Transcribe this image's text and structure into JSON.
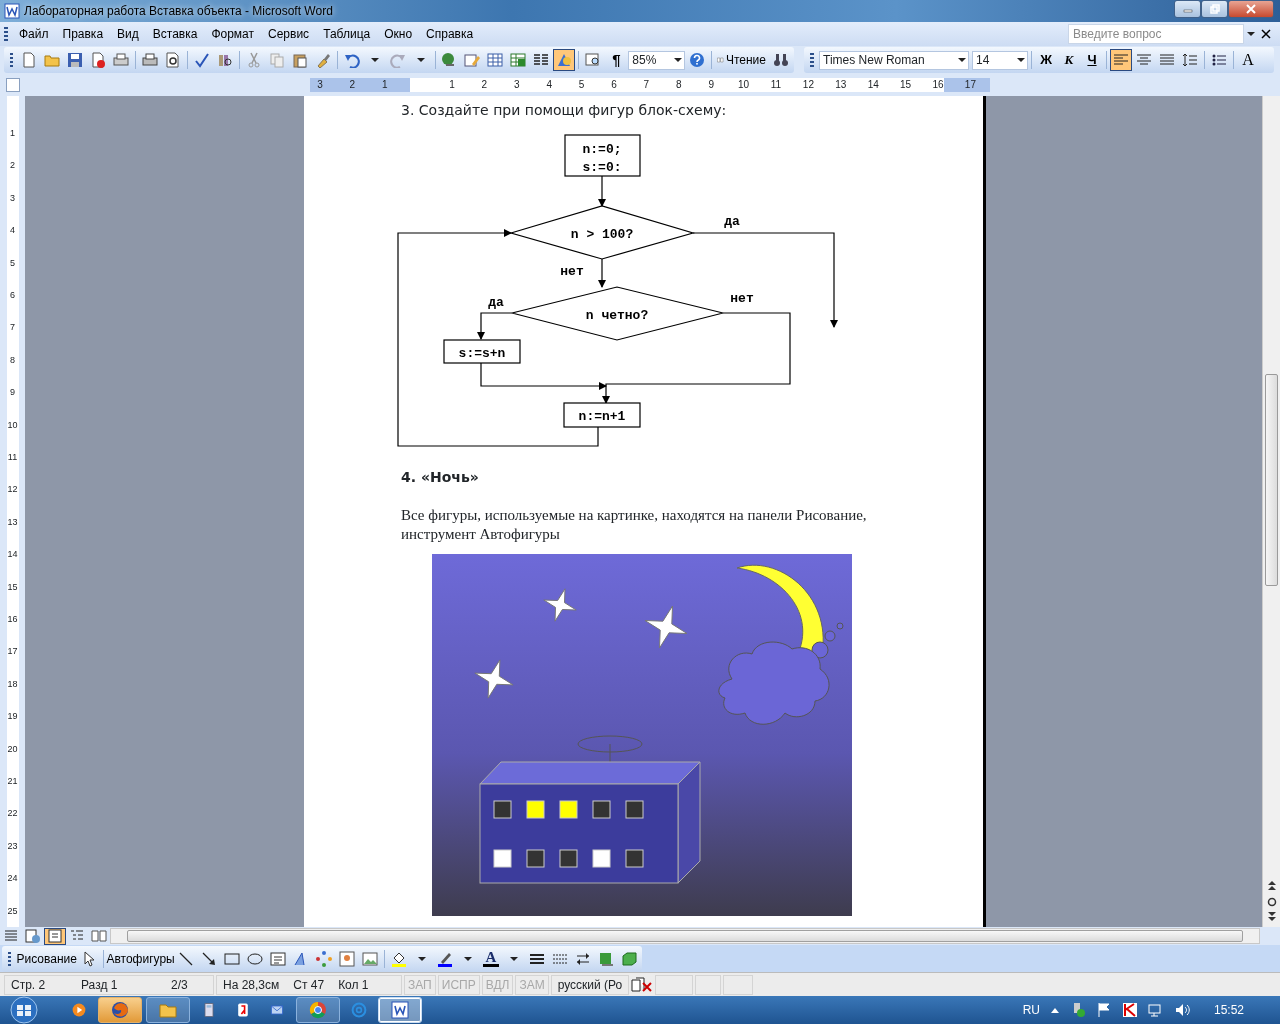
{
  "window": {
    "title": "Лабораторная работа Вставка объекта - Microsoft Word"
  },
  "menu": [
    {
      "label": "Файл"
    },
    {
      "label": "Правка"
    },
    {
      "label": "Вид"
    },
    {
      "label": "Вставка"
    },
    {
      "label": "Формат"
    },
    {
      "label": "Сервис"
    },
    {
      "label": "Таблица"
    },
    {
      "label": "Окно"
    },
    {
      "label": "Справка"
    }
  ],
  "help_box": {
    "placeholder": "Введите вопрос"
  },
  "standard_toolbar": {
    "show_marks_glyph": "¶",
    "zoom": "85%",
    "read_button": "Чтение",
    "drawing_toggle": {
      "on": true
    }
  },
  "formatting_toolbar": {
    "font": "Times New Roman",
    "size": "14",
    "grow_font_glyph": "A",
    "styles": [
      {
        "label": "Ж",
        "on": false
      },
      {
        "label": "К",
        "on": false
      },
      {
        "label": "Ч",
        "on": false
      }
    ],
    "alignment": [
      {
        "kind": "left",
        "selected": true
      },
      {
        "kind": "center",
        "selected": false
      },
      {
        "kind": "justify",
        "selected": false
      }
    ]
  },
  "ruler": {
    "left_numbers": [
      "3",
      "2",
      "1"
    ],
    "numbers": [
      "1",
      "2",
      "3",
      "4",
      "5",
      "6",
      "7",
      "8",
      "9",
      "10",
      "11",
      "12",
      "13",
      "14",
      "15",
      "16",
      "17"
    ]
  },
  "vertical_ruler": {
    "numbers": [
      "1",
      "2",
      "3",
      "4",
      "5",
      "6",
      "7",
      "8",
      "9",
      "10",
      "11",
      "12",
      "13",
      "14",
      "15",
      "16",
      "17",
      "18",
      "19",
      "20",
      "21",
      "22",
      "23",
      "24",
      "25"
    ]
  },
  "document": {
    "heading_1": "3. Создайте при помощи фигур блок-схему:",
    "flowchart": {
      "start_block": [
        "n:=0;",
        "s:=0:"
      ],
      "condition_1": "n > 100?",
      "condition_1_yes": "да",
      "condition_1_no": "нет",
      "condition_2": "n четно?",
      "condition_2_yes": "да",
      "condition_2_no": "нет",
      "sum_block": "s:=s+n",
      "step_block": "n:=n+1"
    },
    "heading_2": "4. «Ночь»",
    "paragraph": "Все фигуры, используемые на картинке, находятся на панели Рисование, инструмент Автофигуры"
  },
  "view_buttons": [
    {
      "kind": "normal",
      "selected": false
    },
    {
      "kind": "web",
      "selected": false
    },
    {
      "kind": "print",
      "selected": true
    },
    {
      "kind": "outline",
      "selected": false
    },
    {
      "kind": "reading",
      "selected": false
    }
  ],
  "drawing_toolbar": {
    "drawing_menu": "Рисование",
    "autoshapes_menu": "Автофигуры",
    "font_color_glyph": "A"
  },
  "status_bar": {
    "page": "Стр. 2",
    "section": "Разд 1",
    "pages": "2/3",
    "position": "На 28,3см",
    "line": "Ст 47",
    "column": "Кол 1",
    "modes": [
      {
        "label": "ЗАП",
        "on": false
      },
      {
        "label": "ИСПР",
        "on": false
      },
      {
        "label": "ВДЛ",
        "on": false
      },
      {
        "label": "ЗАМ",
        "on": false
      }
    ],
    "language": "русский (Ро"
  },
  "taskbar": {
    "items": [
      {
        "kind": "media",
        "running": false,
        "flashing": false,
        "selected": false
      },
      {
        "kind": "browser-fox",
        "running": true,
        "flashing": true,
        "selected": false
      },
      {
        "kind": "folder",
        "running": true,
        "flashing": false,
        "selected": false
      },
      {
        "kind": "calculator",
        "running": false,
        "flashing": false,
        "selected": false
      },
      {
        "kind": "yandex",
        "running": false,
        "flashing": false,
        "selected": false
      },
      {
        "kind": "mail",
        "running": false,
        "flashing": false,
        "selected": false
      },
      {
        "kind": "browser-circle",
        "running": true,
        "flashing": false,
        "selected": false
      },
      {
        "kind": "browser-at",
        "running": false,
        "flashing": false,
        "selected": false
      },
      {
        "kind": "word",
        "running": true,
        "flashing": false,
        "selected": true
      }
    ],
    "language": "RU",
    "clock": "15:52"
  }
}
